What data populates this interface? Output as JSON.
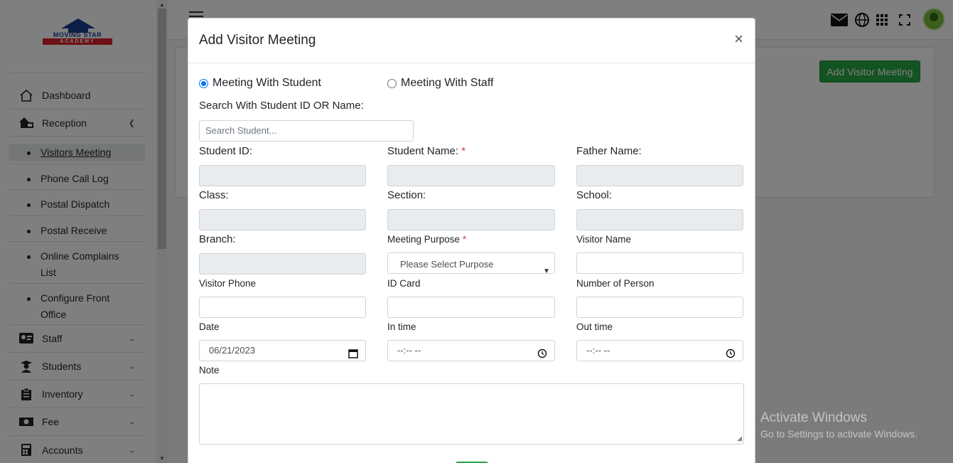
{
  "app": {
    "logo_line1": "MOVING STAR",
    "logo_line2": "ACADEMY",
    "accent": "#28a745",
    "modal_backdrop": "rgba(0,0,0,0.5)"
  },
  "sidebar": {
    "items": [
      {
        "label": "Dashboard",
        "icon": "home-icon"
      },
      {
        "label": "Reception",
        "icon": "reception-icon",
        "expanded": true
      },
      {
        "label": "Staff",
        "icon": "staff-icon"
      },
      {
        "label": "Students",
        "icon": "students-icon"
      },
      {
        "label": "Inventory",
        "icon": "clipboard-icon"
      },
      {
        "label": "Fee",
        "icon": "money-icon"
      },
      {
        "label": "Accounts",
        "icon": "calculator-icon"
      }
    ],
    "sub_items": [
      {
        "label": "Visitors Meeting",
        "active": true
      },
      {
        "label": "Phone Call Log"
      },
      {
        "label": "Postal Dispatch"
      },
      {
        "label": "Postal Receive"
      },
      {
        "label": "Online Complains List"
      },
      {
        "label": "Configure Front Office"
      }
    ]
  },
  "header": {
    "icons": [
      "mail-icon",
      "globe-icon",
      "grid-icon",
      "fullscreen-icon",
      "avatar"
    ]
  },
  "page": {
    "add_button_label": "Add Visitor Meeting"
  },
  "modal": {
    "title": "Add Visitor Meeting",
    "close_glyph": "×",
    "radio_student": "Meeting With Student",
    "radio_staff": "Meeting With Staff",
    "search_label": "Search With Student ID OR Name:",
    "search_placeholder": "Search Student...",
    "fields": {
      "student_id": "Student ID:",
      "student_name": "Student Name:",
      "father_name": "Father Name:",
      "class": "Class:",
      "section": "Section:",
      "school": "School:",
      "branch": "Branch:",
      "meeting_purpose": "Meeting Purpose",
      "visitor_name": "Visitor Name",
      "visitor_phone": "Visitor Phone",
      "id_card": "ID Card",
      "number_of_person": "Number of Person",
      "date": "Date",
      "in_time": "In time",
      "out_time": "Out time",
      "note": "Note"
    },
    "required_mark": "*",
    "purpose_selected": "Please Select Purpose",
    "date_value": "06/21/2023",
    "in_time_value": "--:-- --",
    "out_time_value": "--:-- --"
  },
  "watermark": {
    "line1": "Activate Windows",
    "line2": "Go to Settings to activate Windows."
  }
}
